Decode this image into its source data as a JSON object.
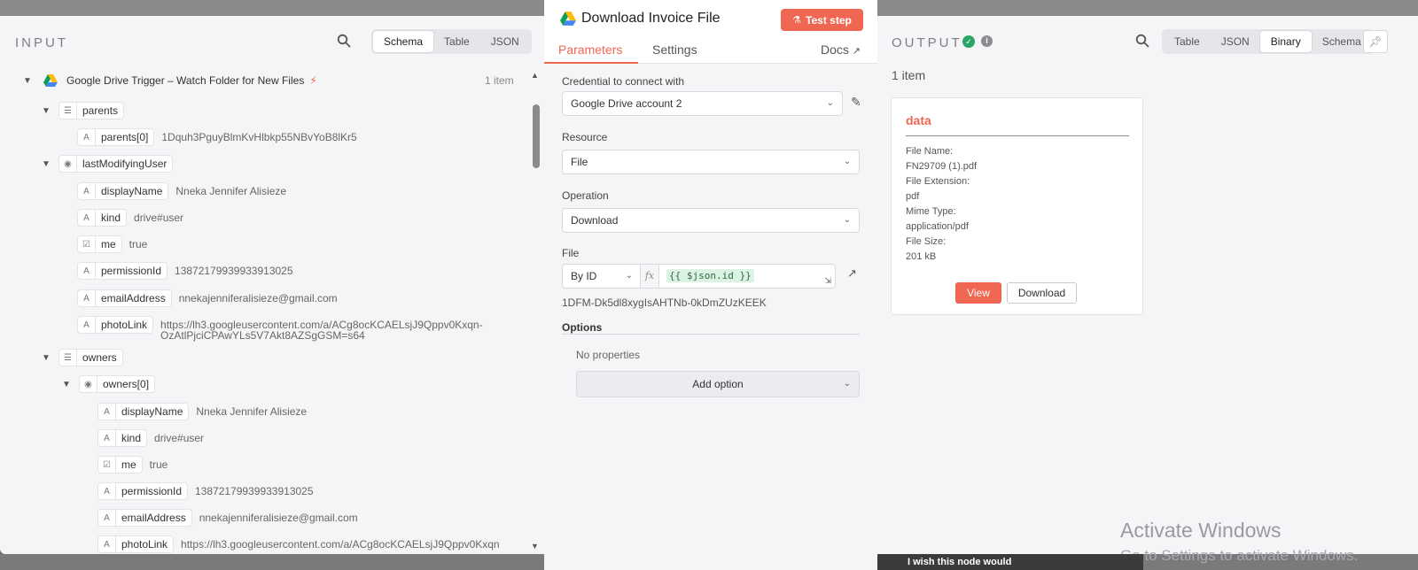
{
  "input": {
    "title": "INPUT",
    "view_options": [
      "Schema",
      "Table",
      "JSON"
    ],
    "selected_view": "Schema",
    "trigger_label": "Google Drive Trigger – Watch Folder for New Files",
    "item_count": "1 item",
    "tree": {
      "parents": "parents",
      "parents0_key": "parents[0]",
      "parents0_val": "1Dquh3PguyBlmKvHlbkp55NBvYoB8lKr5",
      "lmu": "lastModifyingUser",
      "lmu_displayName_key": "displayName",
      "lmu_displayName_val": "Nneka Jennifer Alisieze",
      "lmu_kind_key": "kind",
      "lmu_kind_val": "drive#user",
      "lmu_me_key": "me",
      "lmu_me_val": "true",
      "lmu_permissionId_key": "permissionId",
      "lmu_permissionId_val": "13872179939933913025",
      "lmu_email_key": "emailAddress",
      "lmu_email_val": "nnekajenniferalisieze@gmail.com",
      "lmu_photo_key": "photoLink",
      "lmu_photo_val1": "https://lh3.googleusercontent.com/a/ACg8ocKCAELsjJ9Qppv0Kxqn-",
      "lmu_photo_val2": "OzAtlPjciCPAwYLs5V7Akt8AZSgGSM=s64",
      "owners": "owners",
      "owners0": "owners[0]",
      "o_displayName_key": "displayName",
      "o_displayName_val": "Nneka Jennifer Alisieze",
      "o_kind_key": "kind",
      "o_kind_val": "drive#user",
      "o_me_key": "me",
      "o_me_val": "true",
      "o_permissionId_key": "permissionId",
      "o_permissionId_val": "13872179939933913025",
      "o_email_key": "emailAddress",
      "o_email_val": "nnekajenniferalisieze@gmail.com",
      "o_photo_key": "photoLink",
      "o_photo_val": "https://lh3.googleusercontent.com/a/ACg8ocKCAELsjJ9Qppv0Kxqn"
    }
  },
  "node": {
    "title": "Download Invoice File",
    "test_button": "Test step",
    "tabs": [
      "Parameters",
      "Settings"
    ],
    "active_tab": "Parameters",
    "docs": "Docs",
    "credential_label": "Credential to connect with",
    "credential_value": "Google Drive account 2",
    "resource_label": "Resource",
    "resource_value": "File",
    "operation_label": "Operation",
    "operation_value": "Download",
    "file_label": "File",
    "file_mode": "By ID",
    "fx": "fx",
    "file_expression": "{{ $json.id }}",
    "file_id_preview": "1DFM-Dk5dl8xygIsAHTNb-0kDmZUzKEEK",
    "options_label": "Options",
    "no_properties": "No properties",
    "add_option": "Add option"
  },
  "output": {
    "title": "OUTPUT",
    "view_options": [
      "Table",
      "JSON",
      "Binary",
      "Schema"
    ],
    "selected_view": "Binary",
    "item_count": "1 item",
    "card": {
      "title": "data",
      "file_name_label": "File Name:",
      "file_name": "FN29709 (1).pdf",
      "file_ext_label": "File Extension:",
      "file_ext": "pdf",
      "mime_label": "Mime Type:",
      "mime": "application/pdf",
      "size_label": "File Size:",
      "size": "201 kB",
      "view_button": "View",
      "download_button": "Download"
    }
  },
  "overlay": {
    "activate_line1": "Activate Windows",
    "activate_line2": "Go to Settings to activate Windows.",
    "wish_text": "I wish this node would"
  },
  "colors": {
    "accent": "#ef6752",
    "success": "#29a568"
  }
}
